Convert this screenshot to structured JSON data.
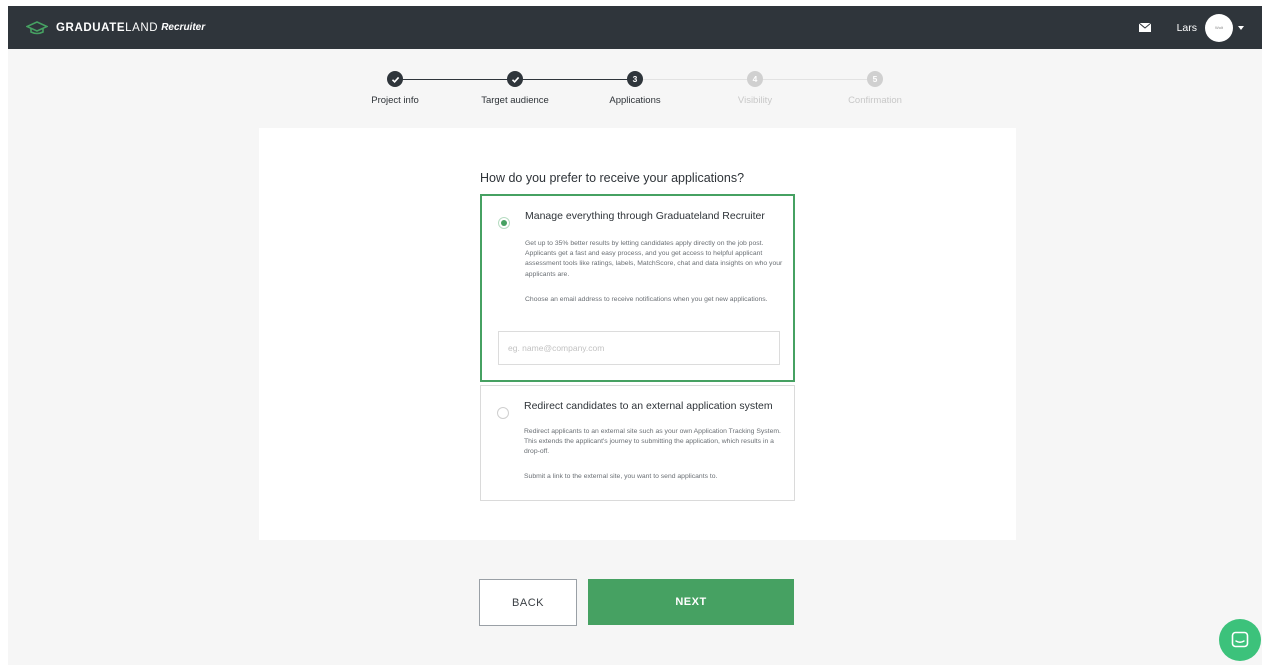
{
  "brand": {
    "bold": "GRADUATE",
    "thin": "LAND",
    "sub": "Recruiter"
  },
  "user": {
    "name": "Lars",
    "avatar_text": "Wolt"
  },
  "colors": {
    "topbar": "#2f353b",
    "accent": "#46a162",
    "step_dark": "#2f353b",
    "step_muted": "#d0d0d0",
    "chat": "#3cc27b"
  },
  "icons": {
    "mail": "mail-icon",
    "chevron": "chevron-down-icon",
    "check": "check-icon",
    "chat": "chat-icon",
    "logo": "graduation-cap-icon"
  },
  "stepper": {
    "steps": [
      {
        "label": "Project info",
        "marker": "",
        "state": "done"
      },
      {
        "label": "Target audience",
        "marker": "",
        "state": "done"
      },
      {
        "label": "Applications",
        "marker": "3",
        "state": "current"
      },
      {
        "label": "Visibility",
        "marker": "4",
        "state": "upcoming"
      },
      {
        "label": "Confirmation",
        "marker": "5",
        "state": "upcoming"
      }
    ]
  },
  "main": {
    "question": "How do you prefer to receive your applications?",
    "options": [
      {
        "title": "Manage everything through Graduateland Recruiter",
        "selected": true,
        "body": "Get up to 35% better results by letting candidates apply directly on the job post. Applicants get a fast and easy process, and you get access to helpful applicant assessment tools like ratings, labels, MatchScore, chat and data insights on who your applicants are.",
        "body2": "Choose an email address to receive notifications when you get new applications.",
        "input_value": "",
        "input_placeholder": "eg. name@company.com"
      },
      {
        "title": "Redirect candidates to an external application system",
        "selected": false,
        "body": "Redirect applicants to an external site such as your own Application Tracking System. This extends the applicant's journey to submitting the application, which results in a drop-off.",
        "body2": "Submit a link to the external site, you want to send applicants to."
      }
    ]
  },
  "buttons": {
    "back": "BACK",
    "next": "NEXT"
  }
}
